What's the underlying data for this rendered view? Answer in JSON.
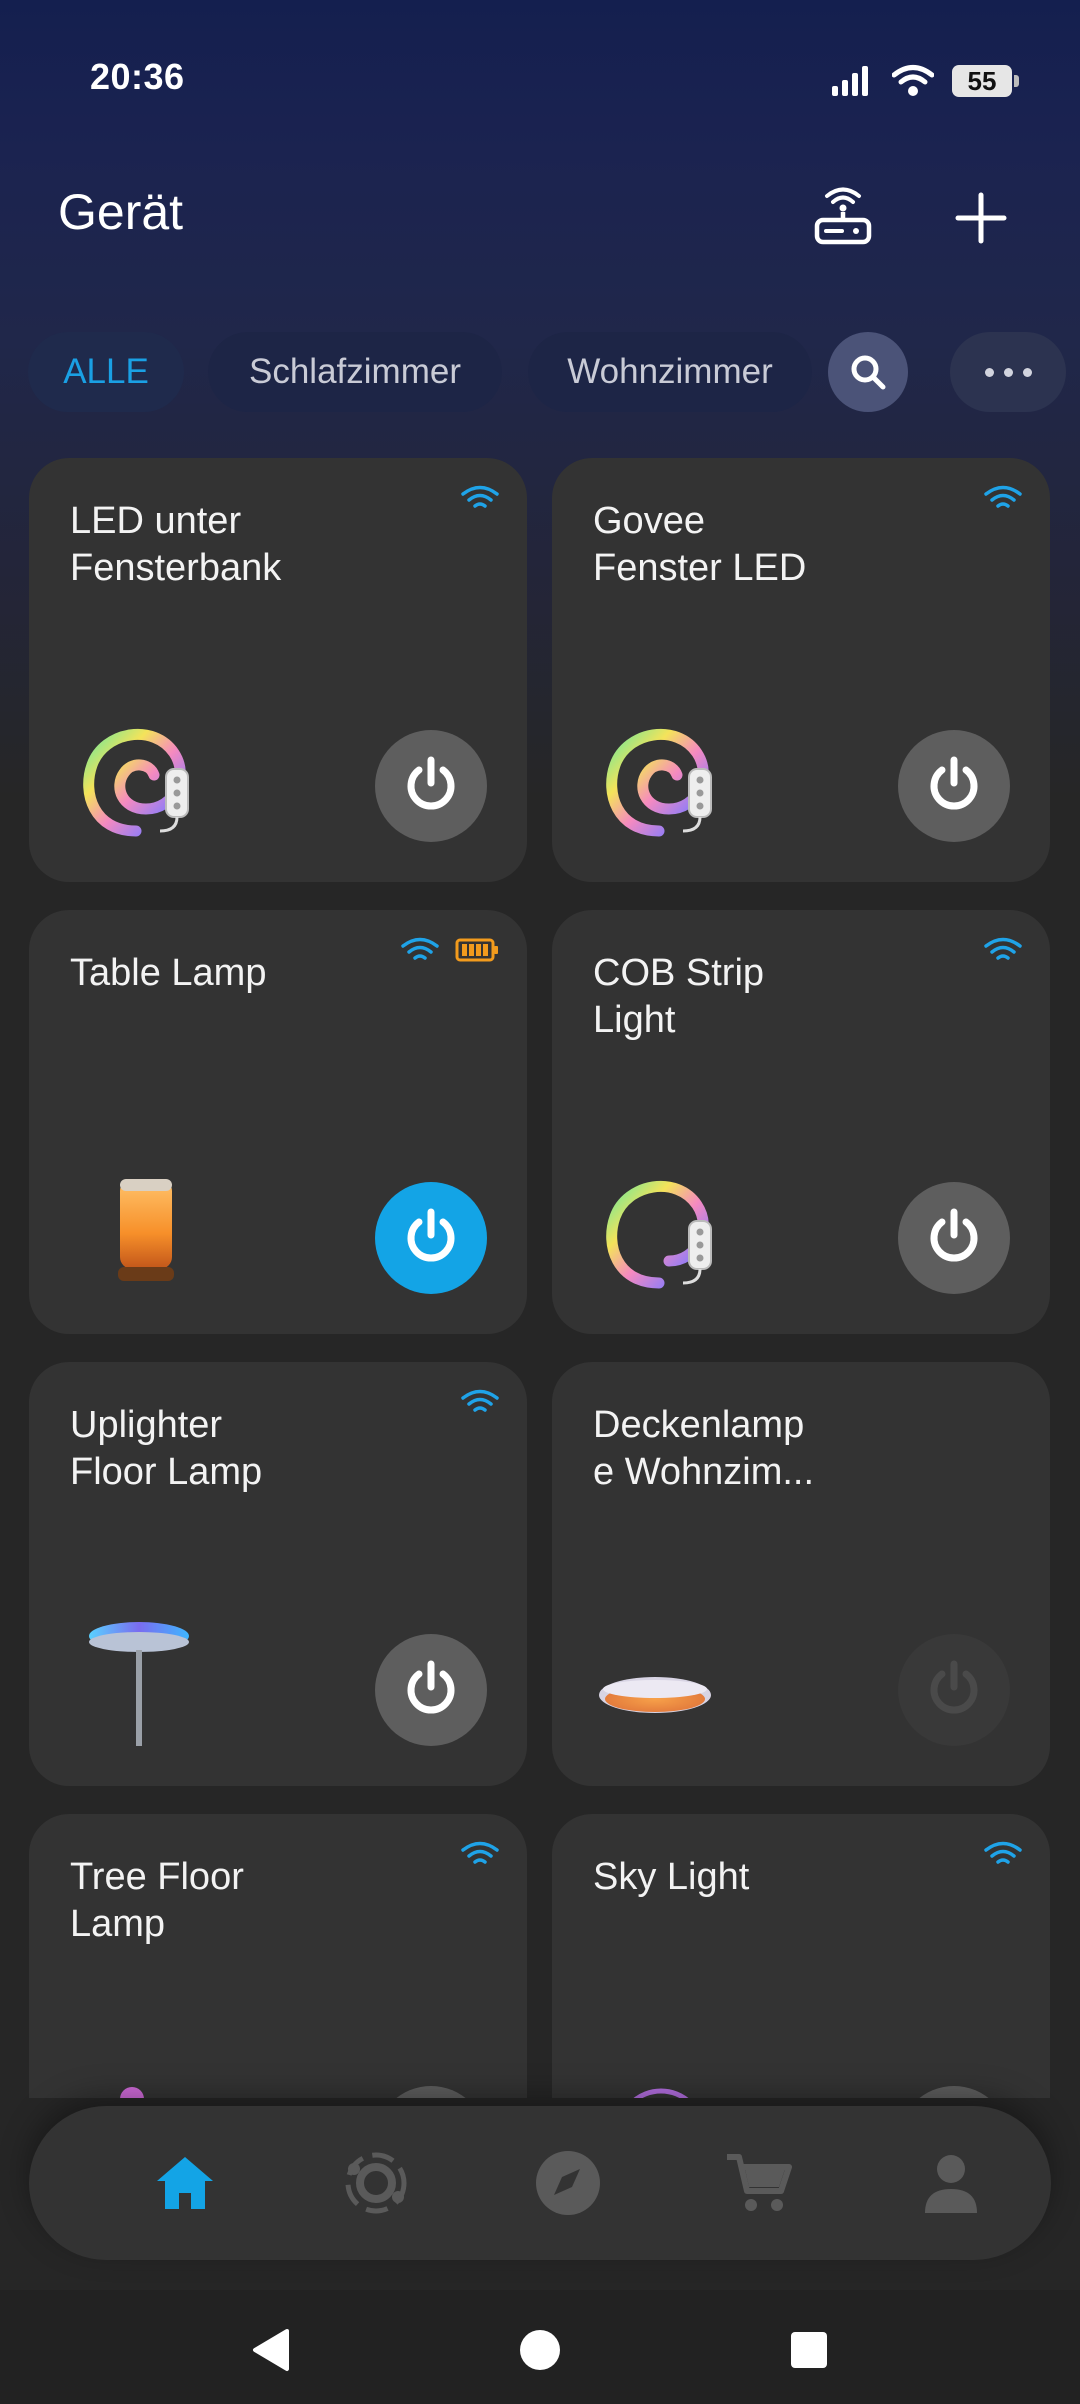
{
  "status_bar": {
    "time": "20:36",
    "battery": "55"
  },
  "header": {
    "title": "Gerät",
    "gateway_icon": "gateway-icon",
    "add_icon": "plus-icon"
  },
  "filters": {
    "chips": [
      "ALLE",
      "Schlafzimmer",
      "Wohnzimmer"
    ],
    "active": "ALLE",
    "search_icon": "search-icon",
    "more_icon": "more-horizontal-icon"
  },
  "devices": [
    {
      "name": "LED unter\nFensterbank",
      "icon": "led-strip-icon",
      "power_state": "standby",
      "connection": "wifi"
    },
    {
      "name": "Govee\nFenster LED",
      "icon": "led-strip-icon",
      "power_state": "standby",
      "connection": "wifi"
    },
    {
      "name": "Table Lamp",
      "icon": "table-lamp-icon",
      "power_state": "on",
      "connection": "wifi",
      "battery": "full"
    },
    {
      "name": "COB Strip\nLight",
      "icon": "led-strip-icon",
      "power_state": "standby",
      "connection": "wifi"
    },
    {
      "name": "Uplighter\nFloor Lamp",
      "icon": "floor-lamp-icon",
      "power_state": "standby",
      "connection": "wifi"
    },
    {
      "name": "Deckenlamp\ne Wohnzim...",
      "icon": "ceiling-lamp-icon",
      "power_state": "offline",
      "connection": "none"
    },
    {
      "name": "Tree Floor\nLamp",
      "icon": "tree-lamp-icon",
      "power_state": "standby",
      "connection": "wifi"
    },
    {
      "name": "Sky Light",
      "icon": "sky-light-icon",
      "power_state": "standby",
      "connection": "wifi"
    }
  ],
  "bottom_nav": {
    "items": [
      "home-icon",
      "scenes-icon",
      "discover-icon",
      "cart-icon",
      "profile-icon"
    ],
    "active": "home-icon"
  },
  "colors": {
    "accent": "#13a4e6",
    "card": "#333333",
    "power_standby": "#5e5e5e",
    "battery_orange": "#f29b1d"
  }
}
